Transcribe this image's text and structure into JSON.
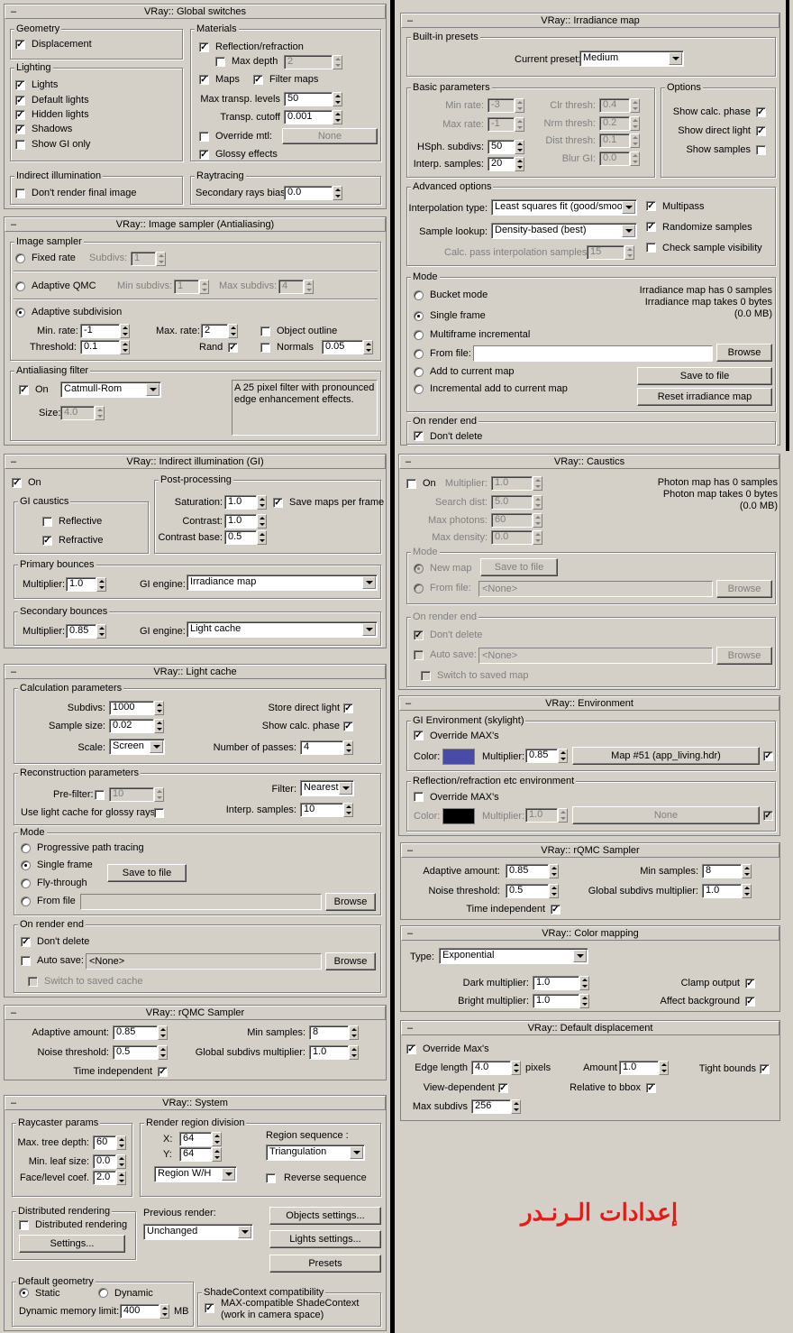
{
  "global_switches": {
    "title": "VRay:: Global switches",
    "geometry_label": "Geometry",
    "displacement": "Displacement",
    "lighting_label": "Lighting",
    "lights": "Lights",
    "default_lights": "Default lights",
    "hidden_lights": "Hidden lights",
    "shadows": "Shadows",
    "show_gi_only": "Show GI only",
    "materials_label": "Materials",
    "reflection_refraction": "Reflection/refraction",
    "max_depth": "Max depth",
    "max_depth_value": "2",
    "maps": "Maps",
    "filter_maps": "Filter maps",
    "max_transp_levels": "Max transp. levels",
    "max_transp_value": "50",
    "transp_cutoff": "Transp. cutoff",
    "transp_cutoff_value": "0.001",
    "override_mtl": "Override mtl:",
    "override_mtl_btn": "None",
    "glossy_effects": "Glossy effects",
    "indirect_label": "Indirect illumination",
    "dont_render_final": "Don't render final image",
    "raytracing_label": "Raytracing",
    "secondary_bias": "Secondary rays bias",
    "secondary_bias_value": "0.0"
  },
  "image_sampler": {
    "title": "VRay:: Image sampler (Antialiasing)",
    "group": "Image sampler",
    "fixed_rate": "Fixed rate",
    "subdivs": "Subdivs:",
    "subdivs_value": "1",
    "adaptive_qmc": "Adaptive QMC",
    "min_subdivs": "Min subdivs:",
    "min_subdivs_value": "1",
    "max_subdivs": "Max subdivs:",
    "max_subdivs_value": "4",
    "adaptive_subdivision": "Adaptive subdivision",
    "min_rate": "Min. rate:",
    "min_rate_value": "-1",
    "max_rate": "Max. rate:",
    "max_rate_value": "2",
    "object_outline": "Object outline",
    "threshold": "Threshold:",
    "threshold_value": "0.1",
    "rand": "Rand",
    "normals": "Normals",
    "normals_value": "0.05",
    "aa_filter": "Antialiasing filter",
    "on": "On",
    "filter_value": "Catmull-Rom",
    "size": "Size:",
    "size_value": "4.0",
    "description": "A 25 pixel filter with pronounced edge enhancement effects."
  },
  "gi": {
    "title": "VRay:: Indirect illumination (GI)",
    "on": "On",
    "caustics": "GI caustics",
    "reflective": "Reflective",
    "refractive": "Refractive",
    "post": "Post-processing",
    "saturation": "Saturation:",
    "saturation_value": "1.0",
    "save_maps": "Save maps per frame",
    "contrast": "Contrast:",
    "contrast_value": "1.0",
    "contrast_base": "Contrast base:",
    "contrast_base_value": "0.5",
    "primary": "Primary bounces",
    "multiplier": "Multiplier:",
    "primary_mult": "1.0",
    "gi_engine": "GI engine:",
    "primary_engine": "Irradiance map",
    "secondary": "Secondary bounces",
    "secondary_mult": "0.85",
    "secondary_engine": "Light cache"
  },
  "light_cache": {
    "title": "VRay:: Light cache",
    "calc": "Calculation parameters",
    "subdivs": "Subdivs:",
    "subdivs_value": "1000",
    "store_direct": "Store direct light",
    "sample_size": "Sample size:",
    "sample_size_value": "0.02",
    "show_calc": "Show calc. phase",
    "scale": "Scale:",
    "scale_value": "Screen",
    "passes": "Number of passes:",
    "passes_value": "4",
    "recon": "Reconstruction parameters",
    "filter": "Filter:",
    "filter_value": "Nearest",
    "prefilter": "Pre-filter:",
    "prefilter_value": "10",
    "glossy": "Use light cache for glossy rays",
    "interp": "Interp. samples:",
    "interp_value": "10",
    "mode": "Mode",
    "progressive": "Progressive path tracing",
    "single": "Single frame",
    "save_btn": "Save to file",
    "fly": "Fly-through",
    "from_file": "From file",
    "browse": "Browse",
    "render_end": "On render end",
    "dont_delete": "Don't delete",
    "auto_save": "Auto save:",
    "none": "<None>",
    "switch": "Switch to saved cache"
  },
  "rqmc_left": {
    "title": "VRay:: rQMC Sampler",
    "adaptive": "Adaptive amount:",
    "adaptive_value": "0.85",
    "min_samples": "Min samples:",
    "min_samples_value": "8",
    "noise": "Noise threshold:",
    "noise_value": "0.5",
    "global_subdivs": "Global subdivs multiplier:",
    "global_value": "1.0",
    "time_independent": "Time independent"
  },
  "system": {
    "title": "VRay:: System",
    "raycaster": "Raycaster params",
    "max_tree": "Max. tree depth:",
    "max_tree_value": "60",
    "min_leaf": "Min. leaf size:",
    "min_leaf_value": "0.0",
    "face_level": "Face/level coef.",
    "face_level_value": "2.0",
    "region": "Render region division",
    "x": "X:",
    "x_value": "64",
    "y": "Y:",
    "y_value": "64",
    "region_wh": "Region W/H",
    "region_seq": "Region sequence :",
    "seq_value": "Triangulation",
    "reverse": "Reverse sequence",
    "distributed": "Distributed rendering",
    "distributed_cb": "Distributed rendering",
    "settings": "Settings...",
    "previous": "Previous render:",
    "previous_value": "Unchanged",
    "objects_settings": "Objects settings...",
    "lights_settings": "Lights settings...",
    "presets": "Presets",
    "default_geom": "Default geometry",
    "static": "Static",
    "dynamic": "Dynamic",
    "mem_limit": "Dynamic memory limit:",
    "mem_value": "400",
    "mb": "MB",
    "shade": "ShadeContext compatibility",
    "max_compat": "MAX-compatible ShadeContext",
    "max_compat2": "(work in camera space)"
  },
  "irradiance": {
    "title": "VRay:: Irradiance map",
    "presets": "Built-in presets",
    "current": "Current preset:",
    "current_value": "Medium",
    "basic": "Basic parameters",
    "min_rate": "Min rate:",
    "min_rate_value": "-3",
    "max_rate": "Max rate:",
    "max_rate_value": "-1",
    "hsph": "HSph. subdivs:",
    "hsph_value": "50",
    "interp": "Interp. samples:",
    "interp_value": "20",
    "clr": "Clr thresh:",
    "clr_value": "0.4",
    "nrm": "Nrm thresh:",
    "nrm_value": "0.2",
    "dist": "Dist thresh:",
    "dist_value": "0.1",
    "blur": "Blur GI:",
    "blur_value": "0.0",
    "options": "Options",
    "show_calc": "Show calc. phase",
    "show_direct": "Show direct light",
    "show_samples": "Show samples",
    "advanced": "Advanced options",
    "interp_type": "Interpolation type:",
    "interp_type_value": "Least squares fit (good/smooth",
    "multipass": "Multipass",
    "lookup": "Sample lookup:",
    "lookup_value": "Density-based (best)",
    "randomize": "Randomize samples",
    "calc_pass": "Calc. pass interpolation samples:",
    "calc_pass_value": "15",
    "check_vis": "Check sample visibility",
    "mode": "Mode",
    "bucket": "Bucket mode",
    "single": "Single frame",
    "multiframe": "Multiframe incremental",
    "from_file": "From file:",
    "browse": "Browse",
    "add": "Add to current map",
    "incremental": "Incremental add to current map",
    "save": "Save to file",
    "reset": "Reset irradiance map",
    "info1": "Irradiance map has 0 samples",
    "info2": "Irradiance map takes 0 bytes",
    "info3": "(0.0 MB)",
    "render_end": "On render end",
    "dont_delete": "Don't delete"
  },
  "caustics": {
    "title": "VRay:: Caustics",
    "on": "On",
    "multiplier": "Multiplier:",
    "mult_value": "1.0",
    "search": "Search dist:",
    "search_value": "5.0",
    "max_photons": "Max photons:",
    "max_photons_value": "60",
    "max_density": "Max density:",
    "max_density_value": "0.0",
    "info1": "Photon map has 0 samples",
    "info2": "Photon map takes 0 bytes",
    "info3": "(0.0 MB)",
    "mode": "Mode",
    "new_map": "New map",
    "save": "Save to file",
    "from_file": "From file:",
    "none": "<None>",
    "browse": "Browse",
    "render_end": "On render end",
    "dont_delete": "Don't delete",
    "auto_save": "Auto save:",
    "switch": "Switch to saved map"
  },
  "environment": {
    "title": "VRay:: Environment",
    "gi_env": "GI Environment (skylight)",
    "override": "Override MAX's",
    "color": "Color:",
    "multiplier": "Multiplier:",
    "gi_mult": "0.85",
    "gi_map": "Map #51 (app_living.hdr)",
    "gi_color": "#4a4aa8",
    "refl_env": "Reflection/refraction etc environment",
    "refl_override": "Override MAX's",
    "refl_mult": "1.0",
    "refl_map": "None",
    "refl_color": "#000000"
  },
  "rqmc_right": {
    "title": "VRay:: rQMC Sampler",
    "adaptive": "Adaptive amount:",
    "adaptive_value": "0.85",
    "min_samples": "Min samples:",
    "min_samples_value": "8",
    "noise": "Noise threshold:",
    "noise_value": "0.5",
    "global_subdivs": "Global subdivs multiplier:",
    "global_value": "1.0",
    "time_independent": "Time independent"
  },
  "color_mapping": {
    "title": "VRay:: Color mapping",
    "type": "Type:",
    "type_value": "Exponential",
    "dark": "Dark multiplier:",
    "dark_value": "1.0",
    "bright": "Bright multiplier:",
    "bright_value": "1.0",
    "clamp": "Clamp output",
    "affect": "Affect background"
  },
  "displacement": {
    "title": "VRay:: Default displacement",
    "override": "Override Max's",
    "edge": "Edge length",
    "edge_value": "4.0",
    "pixels": "pixels",
    "amount": "Amount",
    "amount_value": "1.0",
    "tight": "Tight bounds",
    "view_dep": "View-dependent",
    "relative": "Relative to bbox",
    "max_subdivs": "Max subdivs",
    "max_subdivs_value": "256"
  },
  "caption": "إعدادات الـرنـدر"
}
